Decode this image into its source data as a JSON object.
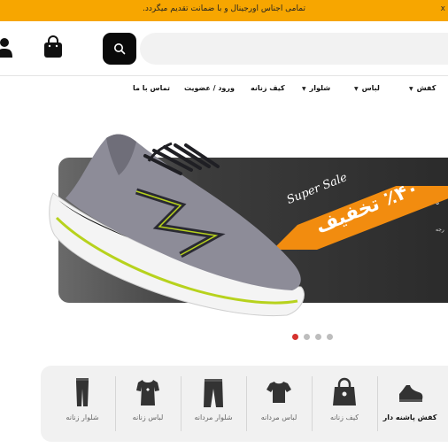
{
  "topbar": {
    "announcement": "تمامی اجناس اورجینال و با ضمانت تقدیم میگردد.",
    "close_label": "x"
  },
  "header": {
    "search_placeholder": "",
    "user_icon": "user-icon",
    "bag_icon": "shopping-bag-icon",
    "search_icon": "search-icon"
  },
  "nav": {
    "items": [
      {
        "label": "کفش",
        "has_dropdown": true
      },
      {
        "label": "لباس",
        "has_dropdown": true
      },
      {
        "label": "شلوار",
        "has_dropdown": true
      },
      {
        "label": "کیف زنانه",
        "has_dropdown": false
      },
      {
        "label": "ورود / عضویت",
        "has_dropdown": false
      },
      {
        "label": "تماس با ما",
        "has_dropdown": false
      }
    ],
    "caret": "▼"
  },
  "banner": {
    "tag": "Super Sale",
    "discount": "٪۴۰ تخفیف",
    "side_text": "ه",
    "side_subtext": "رجه"
  },
  "slider": {
    "count": 4,
    "active_index": 0
  },
  "categories": [
    {
      "label": "کفش پاشنه دار",
      "icon": "heeled-shoe-icon",
      "active": true
    },
    {
      "label": "کیف زنانه",
      "icon": "handbag-icon",
      "active": false
    },
    {
      "label": "لباس مردانه",
      "icon": "tshirt-icon",
      "active": false
    },
    {
      "label": "شلوار مردانه",
      "icon": "pants-icon",
      "active": false
    },
    {
      "label": "لباس زنانه",
      "icon": "womens-top-icon",
      "active": false
    },
    {
      "label": "شلوار زنانه",
      "icon": "leggings-icon",
      "active": false
    }
  ],
  "colors": {
    "accent": "#f7a600",
    "promo_orange": "#f28c0f",
    "active_dot": "#d6322e"
  }
}
